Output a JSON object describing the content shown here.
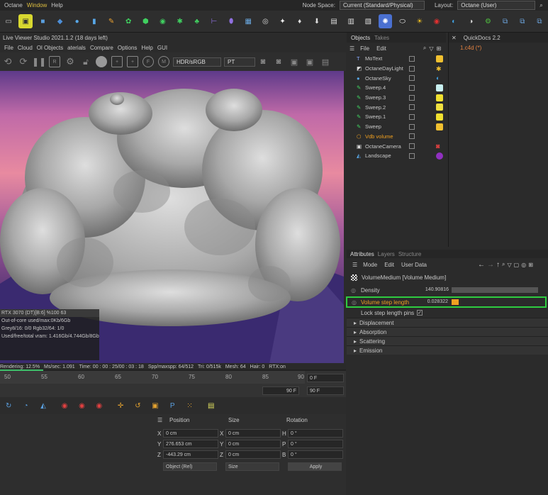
{
  "menubar": {
    "items": [
      "Octane",
      "Window",
      "Help"
    ],
    "node_space_label": "Node Space:",
    "node_space_value": "Current (Standard/Physical)",
    "layout_label": "Layout:",
    "layout_value": "Octane (User)"
  },
  "viewer": {
    "title": "Live Viewer Studio 2021.1.2 (18 days left)",
    "menu": [
      "File",
      "Cloud",
      "Ol Objects",
      "aterials",
      "Compare",
      "Options",
      "Help",
      "GUI"
    ],
    "color_space": "HDR/sRGB",
    "kernel": "PT",
    "stats": [
      "RTX 3070 (DT)[B:6]     %100   63",
      "Out-of-core used/max:0Kb/6Gb",
      "Grey8/16: 0/0        Rgb32/64: 1/0",
      "Used/free/total vram: 1.416Gb/4.744Gb/8Gb"
    ],
    "status": {
      "rendering": "Rendering: 12.5%",
      "ms": "Ms/sec: 1.091",
      "time": "Time: 00 : 00 : 25/00 : 03 : 18",
      "spp": "Spp/maxspp: 64/512",
      "tri": "Tri: 0/515k",
      "mesh": "Mesh: 64",
      "hair": "Hair: 0",
      "rtx": "RTX:on"
    },
    "progress": 0.125
  },
  "timeline": {
    "ticks": [
      "50",
      "55",
      "60",
      "65",
      "70",
      "75",
      "80",
      "85",
      "90"
    ],
    "frame_a": "0 F",
    "frame_b": "90 F",
    "frame_c": "90 F",
    "frame_d": "90 F"
  },
  "coords": {
    "headers": [
      "Position",
      "Size",
      "Rotation"
    ],
    "rows": [
      {
        "axis": "X",
        "pos": "0 cm",
        "saxis": "X",
        "size": "0 cm",
        "raxis": "H",
        "rot": "0 °"
      },
      {
        "axis": "Y",
        "pos": "276.653 cm",
        "saxis": "Y",
        "size": "0 cm",
        "raxis": "P",
        "rot": "0 °"
      },
      {
        "axis": "Z",
        "pos": "-443.29 cm",
        "saxis": "Z",
        "size": "0 cm",
        "raxis": "B",
        "rot": "0 °"
      }
    ],
    "mode": "Object (Rel)",
    "size_mode": "Size",
    "apply": "Apply"
  },
  "objects": {
    "tabs": [
      "Objects",
      "Takes"
    ],
    "menu": [
      "File",
      "Edit"
    ],
    "items": [
      {
        "name": "MoText",
        "color": "#c8c8c8"
      },
      {
        "name": "OctaneDayLight",
        "color": "#c8c8c8"
      },
      {
        "name": "OctaneSky",
        "color": "#c8c8c8"
      },
      {
        "name": "Sweep.4",
        "color": "#c8c8c8"
      },
      {
        "name": "Sweep.3",
        "color": "#c8c8c8"
      },
      {
        "name": "Sweep.2",
        "color": "#c8c8c8"
      },
      {
        "name": "Sweep.1",
        "color": "#c8c8c8"
      },
      {
        "name": "Sweep",
        "color": "#c8c8c8"
      },
      {
        "name": "Vdb volume",
        "color": "#f0a020"
      },
      {
        "name": "OctaneCamera",
        "color": "#c8c8c8"
      },
      {
        "name": "Landscape",
        "color": "#c8c8c8"
      }
    ]
  },
  "quickdocs": {
    "title": "QuickDocs 2.2",
    "file": "1.c4d (*)"
  },
  "attributes": {
    "tabs": [
      "Attributes",
      "Layers",
      "Structure"
    ],
    "menu": [
      "Mode",
      "Edit",
      "User Data"
    ],
    "object_title": "VolumeMedium [Volume Medium]",
    "density_label": "Density",
    "density_value": "140.90816",
    "step_label": "Volume step length",
    "step_value": "0.028322",
    "lock_label": "Lock step length pins",
    "sections": [
      "Displacement",
      "Absorption",
      "Scattering",
      "Emission"
    ],
    "highlight_color": "#2ecc40"
  }
}
